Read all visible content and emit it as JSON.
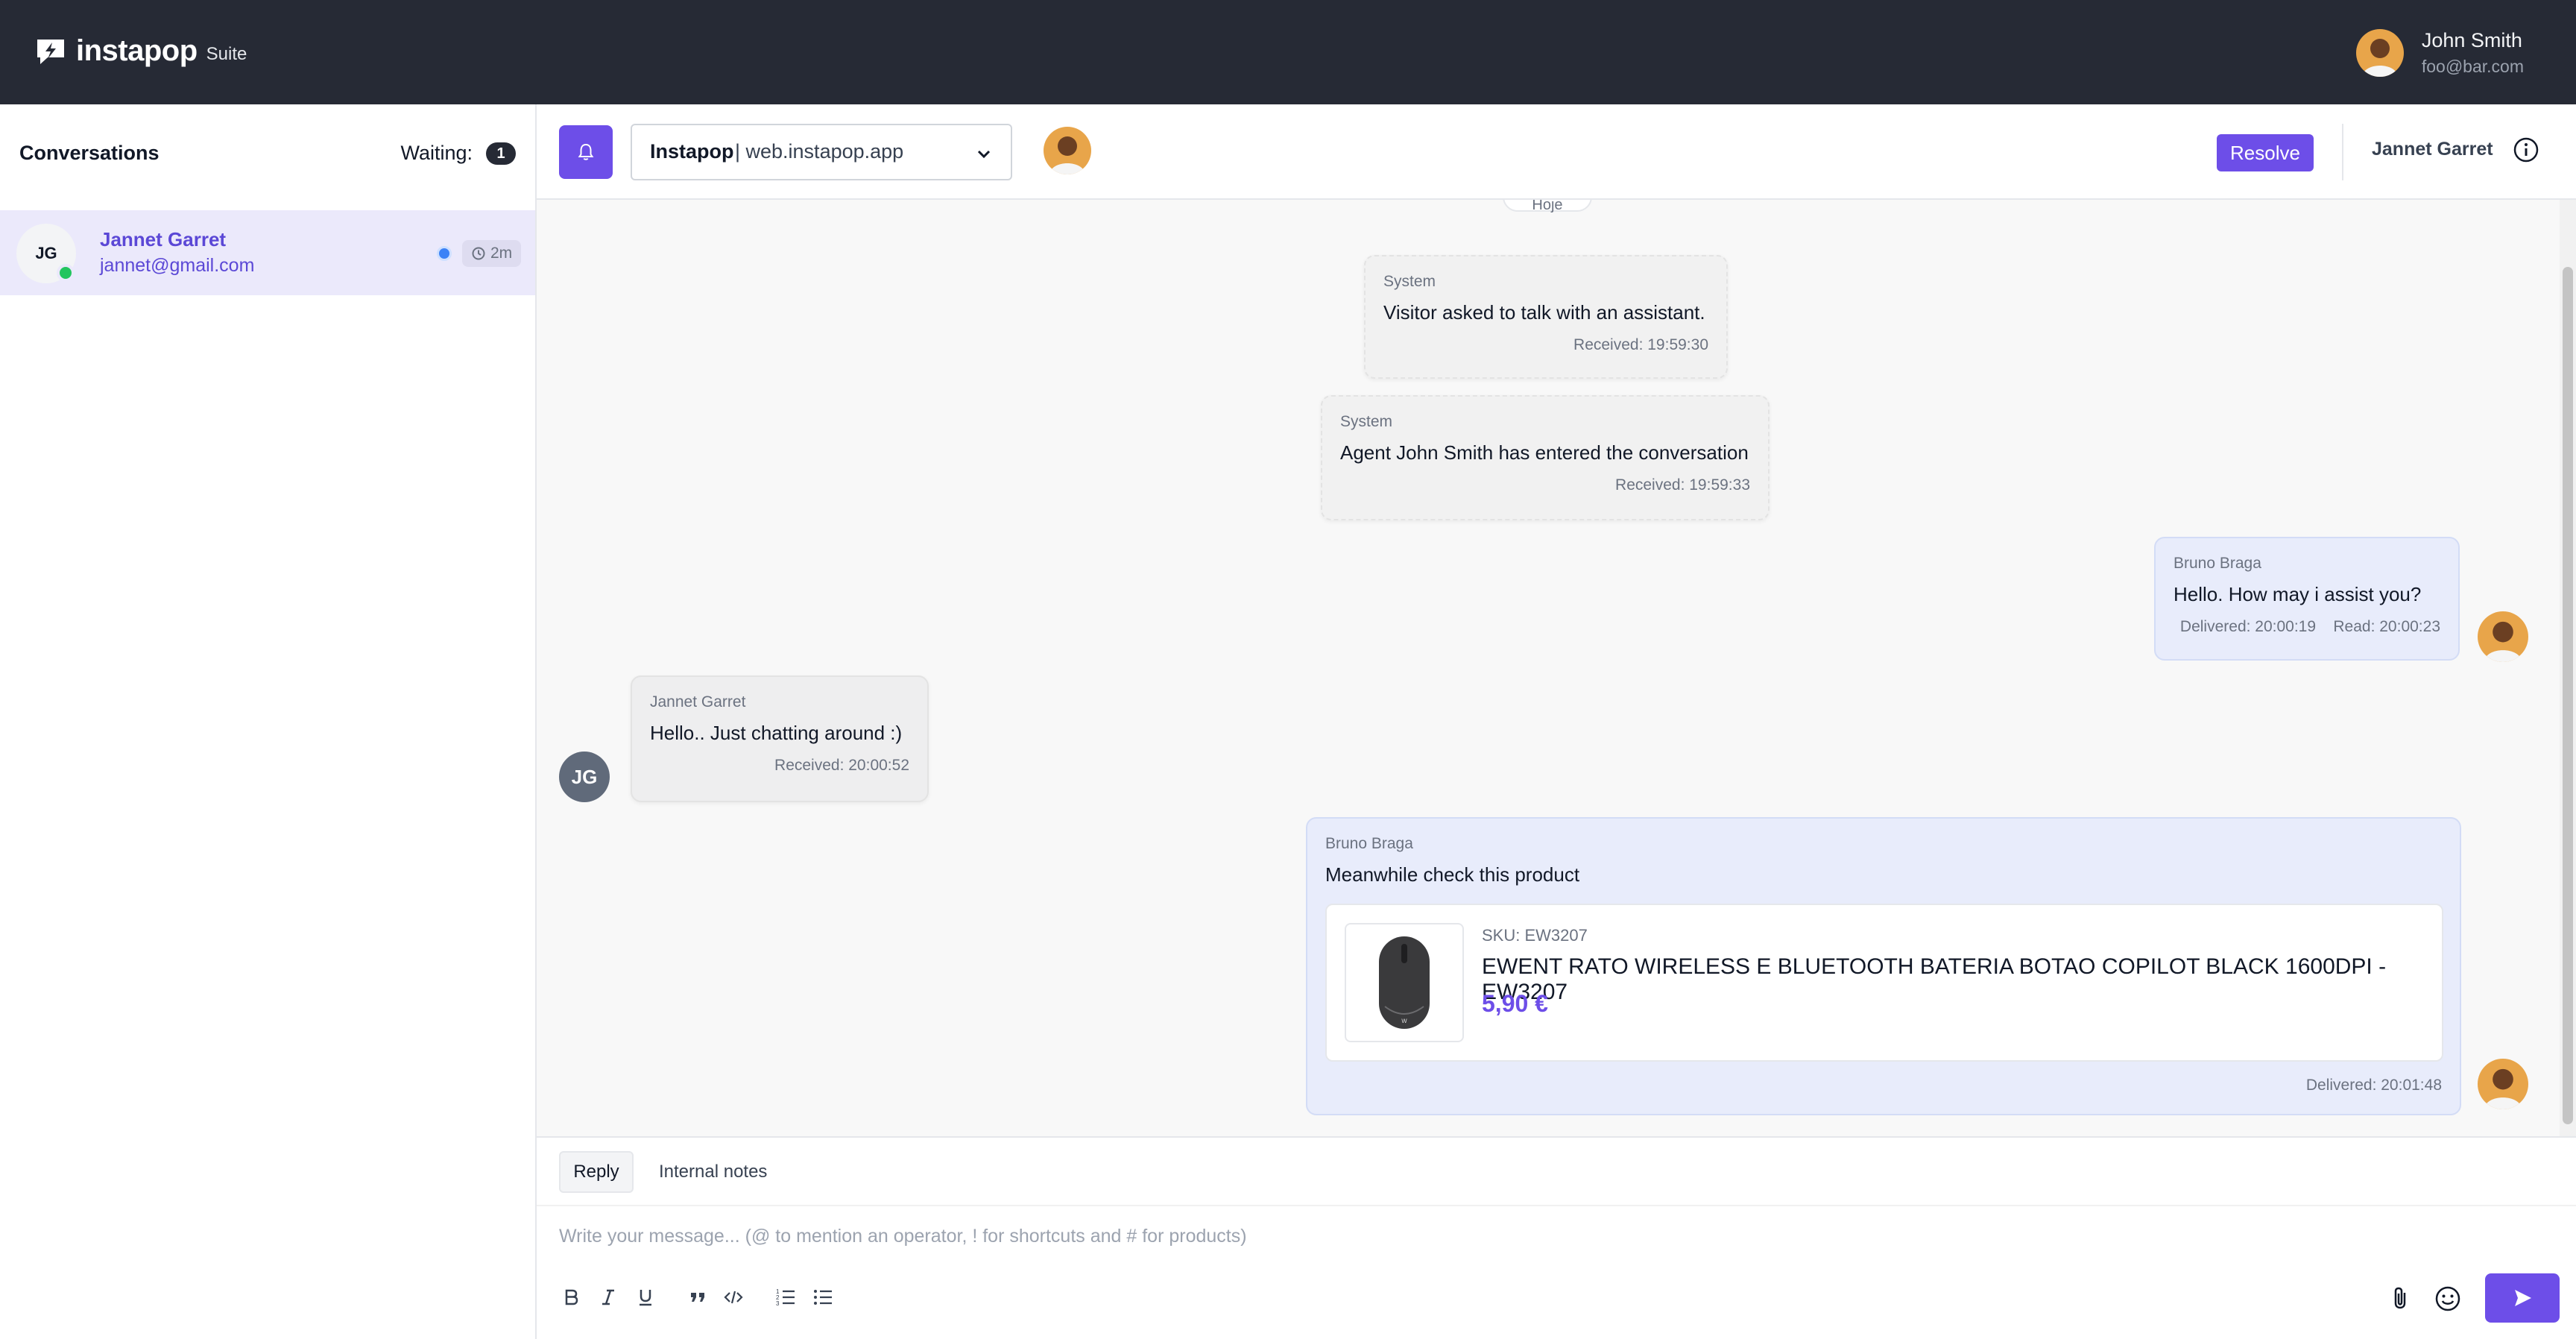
{
  "app": {
    "logo_name": "instapop",
    "logo_suite": "Suite"
  },
  "user": {
    "name": "John Smith",
    "email": "foo@bar.com"
  },
  "sidebar": {
    "title": "Conversations",
    "waiting_label": "Waiting:",
    "waiting_count": "1",
    "conversations": [
      {
        "initials": "JG",
        "name": "Jannet Garret",
        "email": "jannet@gmail.com",
        "time": "2m"
      }
    ]
  },
  "chat_header": {
    "site_brand": "Instapop",
    "site_domain": "| web.instapop.app",
    "resolve_label": "Resolve",
    "contact_name": "Jannet Garret"
  },
  "messages": {
    "date_pill": "Hoje",
    "items": [
      {
        "kind": "system",
        "sender": "System",
        "text": "Visitor asked to talk with an assistant.",
        "meta": "Received: 19:59:30"
      },
      {
        "kind": "system",
        "sender": "System",
        "text": "Agent John Smith has entered the conversation",
        "meta": "Received: 19:59:33"
      },
      {
        "kind": "agent",
        "sender": "Bruno Braga",
        "text": "Hello. How may i assist you?",
        "meta": "Delivered: 20:00:19    Read: 20:00:23"
      },
      {
        "kind": "visitor",
        "sender": "Jannet Garret",
        "text": "Hello.. Just chatting around :)",
        "meta": "Received: 20:00:52",
        "avatar_initials": "JG"
      },
      {
        "kind": "agent",
        "sender": "Bruno Braga",
        "text": "Meanwhile check this product",
        "meta": "Delivered: 20:01:48",
        "product": {
          "sku": "SKU: EW3207",
          "title": "EWENT RATO WIRELESS E BLUETOOTH BATERIA BOTAO COPILOT BLACK 1600DPI - EW3207",
          "price": "5,90 €"
        }
      }
    ]
  },
  "composer": {
    "tab_reply": "Reply",
    "tab_notes": "Internal notes",
    "placeholder": "Write your message... (@ to mention an operator, ! for shortcuts and # for products)",
    "format_buttons": [
      "bold-icon",
      "italic-icon",
      "underline-icon",
      "quote-icon",
      "code-icon",
      "ordered-list-icon",
      "bullet-list-icon"
    ]
  },
  "colors": {
    "topbar": "#262a35",
    "accent": "#6d4ee8",
    "selected_row": "#ebe9fb",
    "online": "#22c55e",
    "unread": "#3b82f6"
  }
}
